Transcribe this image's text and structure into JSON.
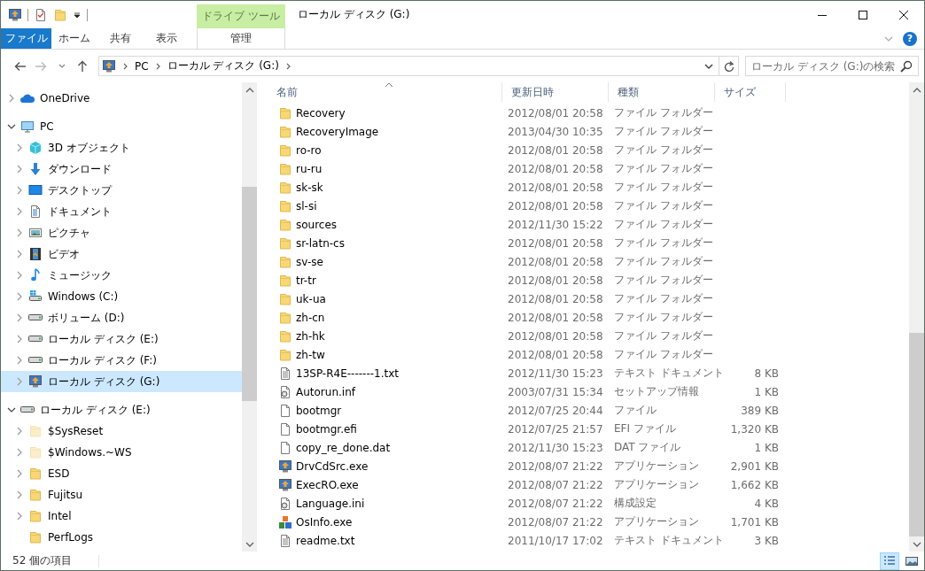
{
  "window": {
    "title": "ローカル ディスク (G:)"
  },
  "ribbon": {
    "context_group": "ドライブ ツール",
    "tabs": [
      {
        "label": "ファイル",
        "kind": "file"
      },
      {
        "label": "ホーム",
        "kind": "normal"
      },
      {
        "label": "共有",
        "kind": "normal"
      },
      {
        "label": "表示",
        "kind": "normal"
      },
      {
        "label": "管理",
        "kind": "context"
      }
    ],
    "help": "?"
  },
  "address": {
    "crumbs": [
      "PC",
      "ローカル ディスク (G:)"
    ],
    "search": {
      "placeholder": "ローカル ディスク (G:)の検索"
    }
  },
  "nav_pane": {
    "tree": [
      {
        "label": "OneDrive",
        "kind": "cloud",
        "expandable": true,
        "expanded": false,
        "selected": false
      },
      {
        "label": "PC",
        "kind": "pc",
        "expandable": true,
        "expanded": true,
        "selected": false,
        "children": [
          {
            "label": "3D オブジェクト",
            "kind": "cube",
            "expandable": true,
            "selected": false
          },
          {
            "label": "ダウンロード",
            "kind": "download",
            "expandable": true,
            "selected": false
          },
          {
            "label": "デスクトップ",
            "kind": "desktop",
            "expandable": true,
            "selected": false
          },
          {
            "label": "ドキュメント",
            "kind": "documents",
            "expandable": true,
            "selected": false
          },
          {
            "label": "ピクチャ",
            "kind": "pictures",
            "expandable": true,
            "selected": false
          },
          {
            "label": "ビデオ",
            "kind": "videos",
            "expandable": true,
            "selected": false
          },
          {
            "label": "ミュージック",
            "kind": "music",
            "expandable": true,
            "selected": false
          },
          {
            "label": "Windows (C:)",
            "kind": "system-drive",
            "expandable": true,
            "selected": false
          },
          {
            "label": "ボリューム (D:)",
            "kind": "drive",
            "expandable": true,
            "selected": false
          },
          {
            "label": "ローカル ディスク (E:)",
            "kind": "drive",
            "expandable": true,
            "selected": false
          },
          {
            "label": "ローカル ディスク (F:)",
            "kind": "drive",
            "expandable": true,
            "selected": false
          },
          {
            "label": "ローカル ディスク (G:)",
            "kind": "app-drive",
            "expandable": true,
            "selected": true
          }
        ]
      },
      {
        "label": "ローカル ディスク (E:)",
        "kind": "drive",
        "expandable": true,
        "expanded": true,
        "selected": false,
        "children": [
          {
            "label": "$SysReset",
            "kind": "hidden-folder",
            "expandable": true,
            "selected": false
          },
          {
            "label": "$Windows.~WS",
            "kind": "hidden-folder",
            "expandable": true,
            "selected": false
          },
          {
            "label": "ESD",
            "kind": "folder",
            "expandable": true,
            "selected": false
          },
          {
            "label": "Fujitsu",
            "kind": "folder",
            "expandable": true,
            "selected": false
          },
          {
            "label": "Intel",
            "kind": "folder",
            "expandable": true,
            "selected": false
          },
          {
            "label": "PerfLogs",
            "kind": "folder",
            "expandable": false,
            "selected": false
          }
        ]
      }
    ]
  },
  "file_list": {
    "columns": [
      {
        "label": "名前",
        "sorted": true
      },
      {
        "label": "更新日時",
        "sorted": false
      },
      {
        "label": "種類",
        "sorted": false
      },
      {
        "label": "サイズ",
        "sorted": false
      }
    ],
    "rows": [
      {
        "name": "Recovery",
        "modified": "2012/08/01 20:58",
        "type": "ファイル フォルダー",
        "kind": "folder"
      },
      {
        "name": "RecoveryImage",
        "modified": "2013/04/30 10:35",
        "type": "ファイル フォルダー",
        "kind": "folder"
      },
      {
        "name": "ro-ro",
        "modified": "2012/08/01 20:58",
        "type": "ファイル フォルダー",
        "kind": "folder"
      },
      {
        "name": "ru-ru",
        "modified": "2012/08/01 20:58",
        "type": "ファイル フォルダー",
        "kind": "folder"
      },
      {
        "name": "sk-sk",
        "modified": "2012/08/01 20:58",
        "type": "ファイル フォルダー",
        "kind": "folder"
      },
      {
        "name": "sl-si",
        "modified": "2012/08/01 20:58",
        "type": "ファイル フォルダー",
        "kind": "folder"
      },
      {
        "name": "sources",
        "modified": "2012/11/30 15:22",
        "type": "ファイル フォルダー",
        "kind": "folder"
      },
      {
        "name": "sr-latn-cs",
        "modified": "2012/08/01 20:58",
        "type": "ファイル フォルダー",
        "kind": "folder"
      },
      {
        "name": "sv-se",
        "modified": "2012/08/01 20:58",
        "type": "ファイル フォルダー",
        "kind": "folder"
      },
      {
        "name": "tr-tr",
        "modified": "2012/08/01 20:58",
        "type": "ファイル フォルダー",
        "kind": "folder"
      },
      {
        "name": "uk-ua",
        "modified": "2012/08/01 20:58",
        "type": "ファイル フォルダー",
        "kind": "folder"
      },
      {
        "name": "zh-cn",
        "modified": "2012/08/01 20:58",
        "type": "ファイル フォルダー",
        "kind": "folder"
      },
      {
        "name": "zh-hk",
        "modified": "2012/08/01 20:58",
        "type": "ファイル フォルダー",
        "kind": "folder"
      },
      {
        "name": "zh-tw",
        "modified": "2012/08/01 20:58",
        "type": "ファイル フォルダー",
        "kind": "folder"
      },
      {
        "name": "13SP-R4E-------1.txt",
        "modified": "2012/11/30 15:23",
        "type": "テキスト ドキュメント",
        "size": "8 KB",
        "kind": "text"
      },
      {
        "name": "Autorun.inf",
        "modified": "2003/07/31 15:34",
        "type": "セットアップ情報",
        "size": "1 KB",
        "kind": "settings"
      },
      {
        "name": "bootmgr",
        "modified": "2012/07/25 20:44",
        "type": "ファイル",
        "size": "389 KB",
        "kind": "blank"
      },
      {
        "name": "bootmgr.efi",
        "modified": "2012/07/25 21:57",
        "type": "EFI ファイル",
        "size": "1,320 KB",
        "kind": "blank"
      },
      {
        "name": "copy_re_done.dat",
        "modified": "2012/11/30 15:23",
        "type": "DAT ファイル",
        "size": "1 KB",
        "kind": "blank"
      },
      {
        "name": "DrvCdSrc.exe",
        "modified": "2012/08/07 21:22",
        "type": "アプリケーション",
        "size": "2,901 KB",
        "kind": "app"
      },
      {
        "name": "ExecRO.exe",
        "modified": "2012/08/07 21:22",
        "type": "アプリケーション",
        "size": "1,662 KB",
        "kind": "app"
      },
      {
        "name": "Language.ini",
        "modified": "2012/08/07 21:22",
        "type": "構成設定",
        "size": "4 KB",
        "kind": "settings"
      },
      {
        "name": "OsInfo.exe",
        "modified": "2012/08/07 21:22",
        "type": "アプリケーション",
        "size": "1,701 KB",
        "kind": "blocks"
      },
      {
        "name": "readme.txt",
        "modified": "2011/10/17 17:02",
        "type": "テキスト ドキュメント",
        "size": "3 KB",
        "kind": "text"
      }
    ]
  },
  "status_bar": {
    "item_count": "52 個の項目",
    "views": [
      {
        "kind": "details",
        "selected": true
      },
      {
        "kind": "thumbnails",
        "selected": false
      }
    ]
  }
}
